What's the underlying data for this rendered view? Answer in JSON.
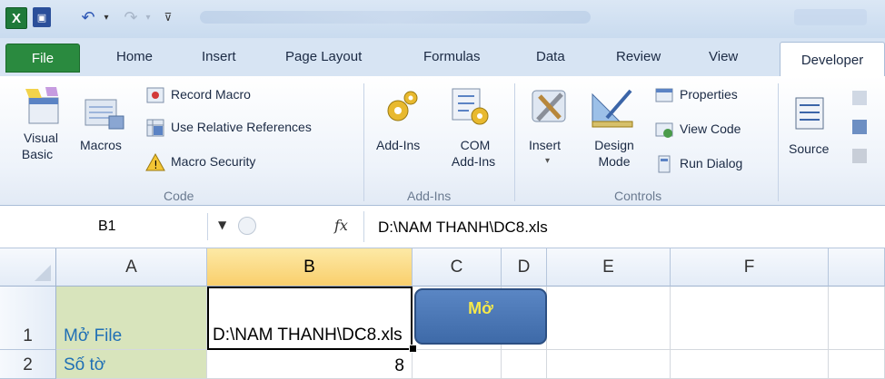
{
  "tabs": [
    "File",
    "Home",
    "Insert",
    "Page Layout",
    "Formulas",
    "Data",
    "Review",
    "View",
    "Developer"
  ],
  "ribbon": {
    "code": {
      "visual_basic": [
        "Visual",
        "Basic"
      ],
      "macros": "Macros",
      "record_macro": "Record Macro",
      "use_relative": "Use Relative References",
      "macro_security": "Macro Security",
      "group": "Code"
    },
    "addins": {
      "addins": "Add-Ins",
      "com_addins": [
        "COM",
        "Add-Ins"
      ],
      "group": "Add-Ins"
    },
    "controls": {
      "insert": "Insert",
      "design_mode": [
        "Design",
        "Mode"
      ],
      "properties": "Properties",
      "view_code": "View Code",
      "run_dialog": "Run Dialog",
      "group": "Controls"
    },
    "xml": {
      "source": "Source"
    }
  },
  "formula_bar": {
    "name_box": "B1",
    "fx": "fx",
    "formula": "D:\\NAM THANH\\DC8.xls"
  },
  "grid": {
    "columns": [
      "A",
      "B",
      "C",
      "D",
      "E",
      "F"
    ],
    "selected_column": "B",
    "rows": [
      {
        "num": "1",
        "a": "Mở File",
        "b": "D:\\NAM THANH\\DC8.xls"
      },
      {
        "num": "2",
        "a": "Số tờ",
        "b": "8"
      }
    ],
    "button_label": "Mở"
  },
  "colors": {
    "file_tab": "#2a8a3f",
    "green_cell": "#d8e4bc",
    "cell_text_blue": "#1f6fb5",
    "button_fill": "#4a76b6",
    "button_text": "#f6e94a"
  }
}
